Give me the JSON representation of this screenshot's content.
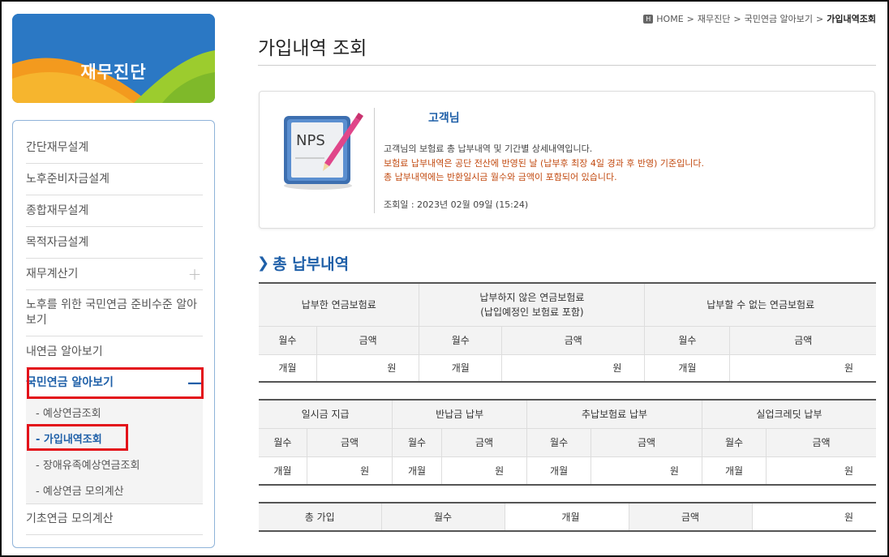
{
  "sidebar": {
    "banner_title": "재무진단",
    "items": [
      {
        "label": "간단재무설계"
      },
      {
        "label": "노후준비자금설계"
      },
      {
        "label": "종합재무설계"
      },
      {
        "label": "목적자금설계"
      },
      {
        "label": "재무계산기",
        "icon": "plus-icon"
      },
      {
        "label": "노후를 위한 국민연금 준비수준 알아보기"
      },
      {
        "label": "내연금 알아보기"
      },
      {
        "label": "국민연금 알아보기",
        "icon": "minus-icon"
      },
      {
        "label": "기초연금 모의계산"
      }
    ],
    "subitems": [
      {
        "label": "- 예상연금조회"
      },
      {
        "label": "- 가입내역조회"
      },
      {
        "label": "- 장애유족예상연금조회"
      },
      {
        "label": "- 예상연금 모의계산"
      }
    ]
  },
  "breadcrumb": {
    "home": "HOME",
    "sep": ">",
    "items": [
      "재무진단",
      "국민연금 알아보기",
      "가입내역조회"
    ]
  },
  "page": {
    "title": "가입내역 조회"
  },
  "info": {
    "logo_text": "NPS",
    "customer": "고객님",
    "line1": "고객님의 보험료 총 납부내역 및 기간별 상세내역입니다.",
    "line2": "보험료 납부내역은 공단 전산에 반영된 날 (납부후 최장 4일 경과 후 반영) 기준입니다.",
    "line3": "총 납부내역에는 반환일시금 월수와 금액이 포함되어 있습니다.",
    "date": "조회일 : 2023년 02월 09일 (15:24)"
  },
  "section": {
    "title": "총 납부내역"
  },
  "table1": {
    "groups": [
      "납부한 연금보험료",
      "납부하지 않은 연금보험료\n(납입예정인 보험료 포함)",
      "납부할 수 없는 연금보험료"
    ],
    "sub": [
      "월수",
      "금액"
    ],
    "row": [
      "개월",
      "원"
    ]
  },
  "table2": {
    "groups": [
      "일시금 지급",
      "반납금 납부",
      "추납보험료 납부",
      "실업크레딧 납부"
    ],
    "sub": [
      "월수",
      "금액"
    ],
    "row": [
      "개월",
      "원"
    ]
  },
  "table3": {
    "label": "총 가입",
    "months_label": "월수",
    "months_unit": "개월",
    "amount_label": "금액",
    "amount_unit": "원"
  },
  "colors": {
    "accent": "#1e5fa8",
    "highlight": "#e3121a",
    "notice": "#c24a10"
  }
}
